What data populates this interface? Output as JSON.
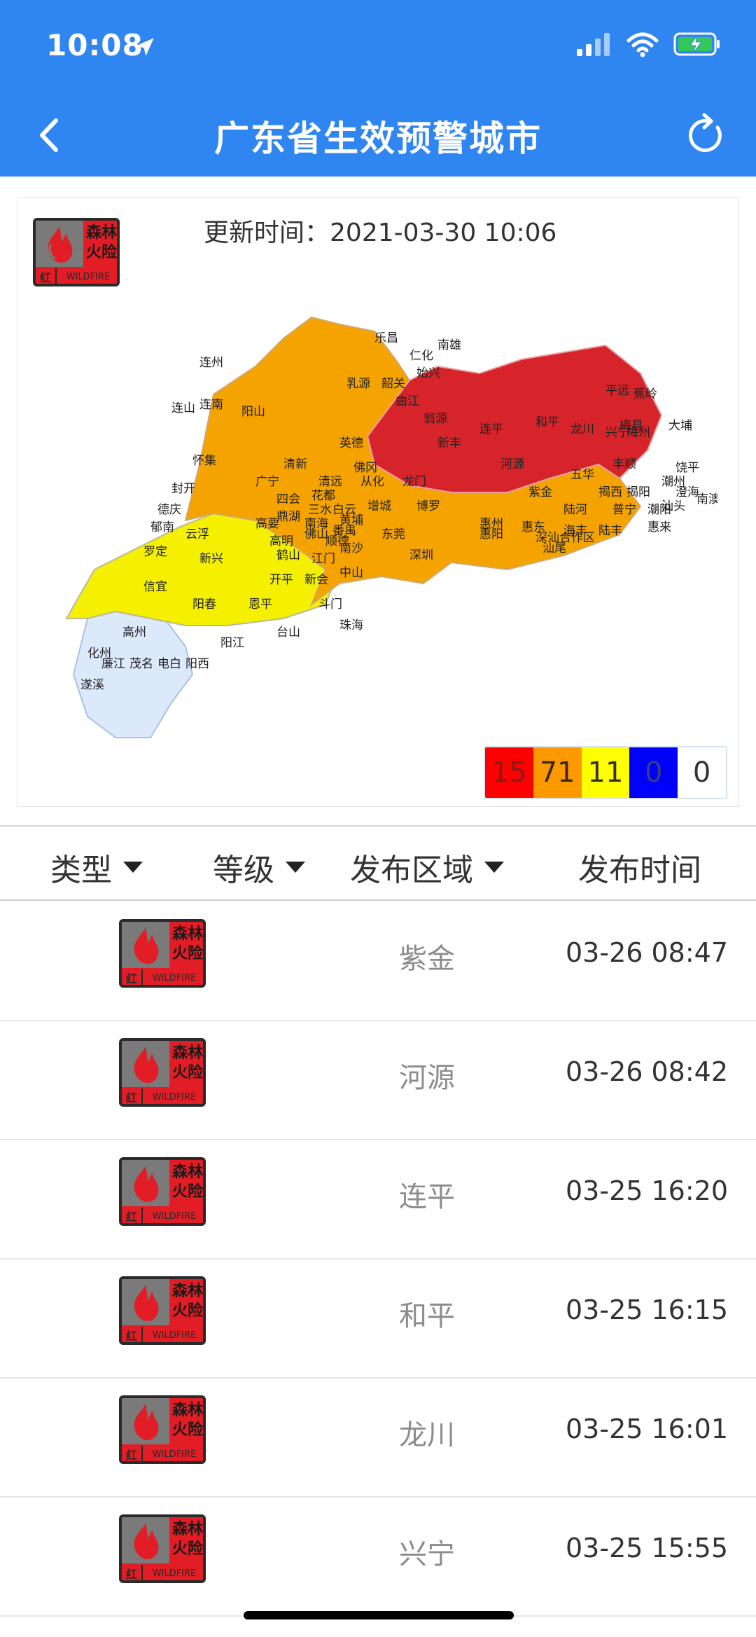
{
  "status_bar": {
    "time": "10:08"
  },
  "nav": {
    "title": "广东省生效预警城市"
  },
  "badge": {
    "line1": "森林",
    "line2": "火险",
    "level": "红",
    "en": "WILDFIRE",
    "color_red": "#e21d25",
    "color_gray": "#777777"
  },
  "map": {
    "update_label": "更新时间：",
    "update_time": "2021-03-30 10:06",
    "labels": [
      "乐昌",
      "仁化",
      "南雄",
      "连州",
      "乳源",
      "韶关",
      "始兴",
      "曲江",
      "连山",
      "连南",
      "阳山",
      "翁源",
      "英德",
      "新丰",
      "连平",
      "和平",
      "龙川",
      "兴宁",
      "平远",
      "蕉岭",
      "梅县",
      "梅州",
      "大埔",
      "怀集",
      "清新",
      "佛冈",
      "河源",
      "五华",
      "丰顺",
      "饶平",
      "潮州",
      "揭阳",
      "广宁",
      "清远",
      "从化",
      "龙门",
      "封开",
      "四会",
      "花都",
      "紫金",
      "揭西",
      "澄海",
      "汕头",
      "南澳",
      "德庆",
      "鼎湖",
      "三水",
      "白云",
      "增城",
      "博罗",
      "陆河",
      "普宁",
      "潮阳",
      "高要",
      "南海",
      "黄埔",
      "郁南",
      "云浮",
      "佛山",
      "番禺",
      "惠州",
      "惠东",
      "海丰",
      "陆丰",
      "惠来",
      "高明",
      "顺德",
      "东莞",
      "惠阳",
      "深汕合作区",
      "汕尾",
      "罗定",
      "新兴",
      "鹤山",
      "江门",
      "南沙",
      "深圳",
      "信宜",
      "开平",
      "新会",
      "中山",
      "阳春",
      "恩平",
      "斗门",
      "珠海",
      "高州",
      "台山",
      "化州",
      "阳江",
      "廉江",
      "茂名",
      "电白",
      "阳西",
      "遂溪"
    ]
  },
  "legend": [
    {
      "value": "15",
      "bg": "#ff0000",
      "fg": "#8a1a1a"
    },
    {
      "value": "71",
      "bg": "#ff9900",
      "fg": "#3a2a10"
    },
    {
      "value": "11",
      "bg": "#ffff00",
      "fg": "#333333"
    },
    {
      "value": "0",
      "bg": "#0000ff",
      "fg": "#3a3a88"
    },
    {
      "value": "0",
      "bg": "#ffffff",
      "fg": "#333333"
    }
  ],
  "table": {
    "headers": {
      "type": "类型",
      "level": "等级",
      "area": "发布区域",
      "time": "发布时间"
    },
    "rows": [
      {
        "area": "紫金",
        "time": "03-26 08:47"
      },
      {
        "area": "河源",
        "time": "03-26 08:42"
      },
      {
        "area": "连平",
        "time": "03-25 16:20"
      },
      {
        "area": "和平",
        "time": "03-25 16:15"
      },
      {
        "area": "龙川",
        "time": "03-25 16:01"
      },
      {
        "area": "兴宁",
        "time": "03-25 15:55"
      }
    ]
  }
}
